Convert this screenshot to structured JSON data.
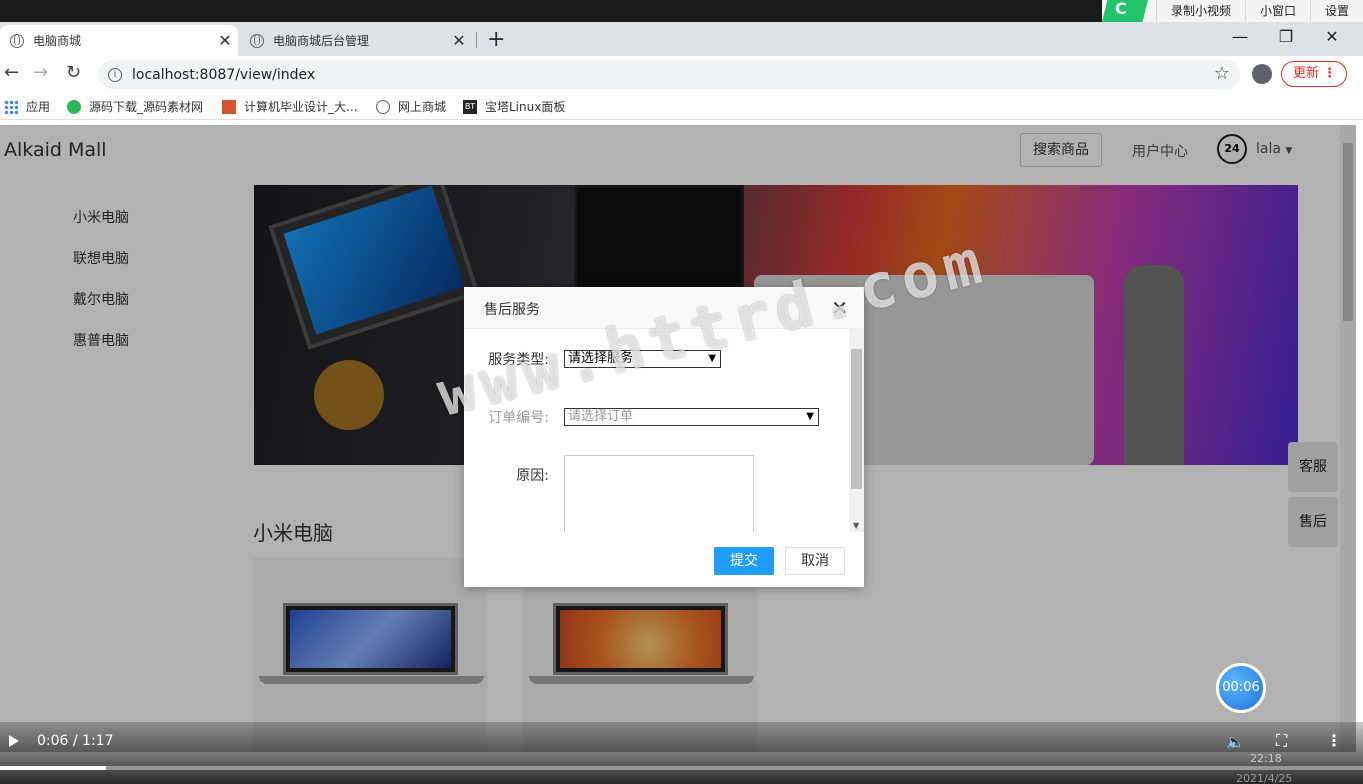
{
  "recorder": {
    "items": [
      "录制小视频",
      "小窗口",
      "设置"
    ]
  },
  "browser": {
    "tabs": [
      {
        "title": "电脑商城",
        "active": true
      },
      {
        "title": "电脑商城后台管理",
        "active": false
      }
    ],
    "url": "localhost:8087/view/index",
    "update_label": "更新",
    "bookmarks": [
      "应用",
      "源码下载_源码素材网",
      "计算机毕业设计_大...",
      "网上商城",
      "宝塔Linux面板"
    ]
  },
  "site": {
    "brand": "Alkaid Mall",
    "search_button": "搜索商品",
    "user_center": "用户中心",
    "support_badge": "24",
    "username": "lala",
    "categories": [
      "小米电脑",
      "联想电脑",
      "戴尔电脑",
      "惠普电脑"
    ],
    "section_title": "小米电脑",
    "float_service": "客服",
    "float_aftersale": "售后"
  },
  "modal": {
    "title": "售后服务",
    "service_type_label": "服务类型:",
    "service_type_value": "请选择服务",
    "order_label": "订单编号:",
    "order_value": "请选择订单",
    "reason_label": "原因:",
    "submit": "提交",
    "cancel": "取消"
  },
  "watermark": "www.httrd.com",
  "timer": "00:06",
  "video": {
    "time": "0:06 / 1:17",
    "progress_fraction": 0.078
  },
  "taskbar": {
    "clock": "22:18",
    "date": "2021/4/25"
  },
  "colors": {
    "primary_button": "#1e9fff",
    "update_red": "#d93025",
    "recorder_green": "#21c36b"
  }
}
